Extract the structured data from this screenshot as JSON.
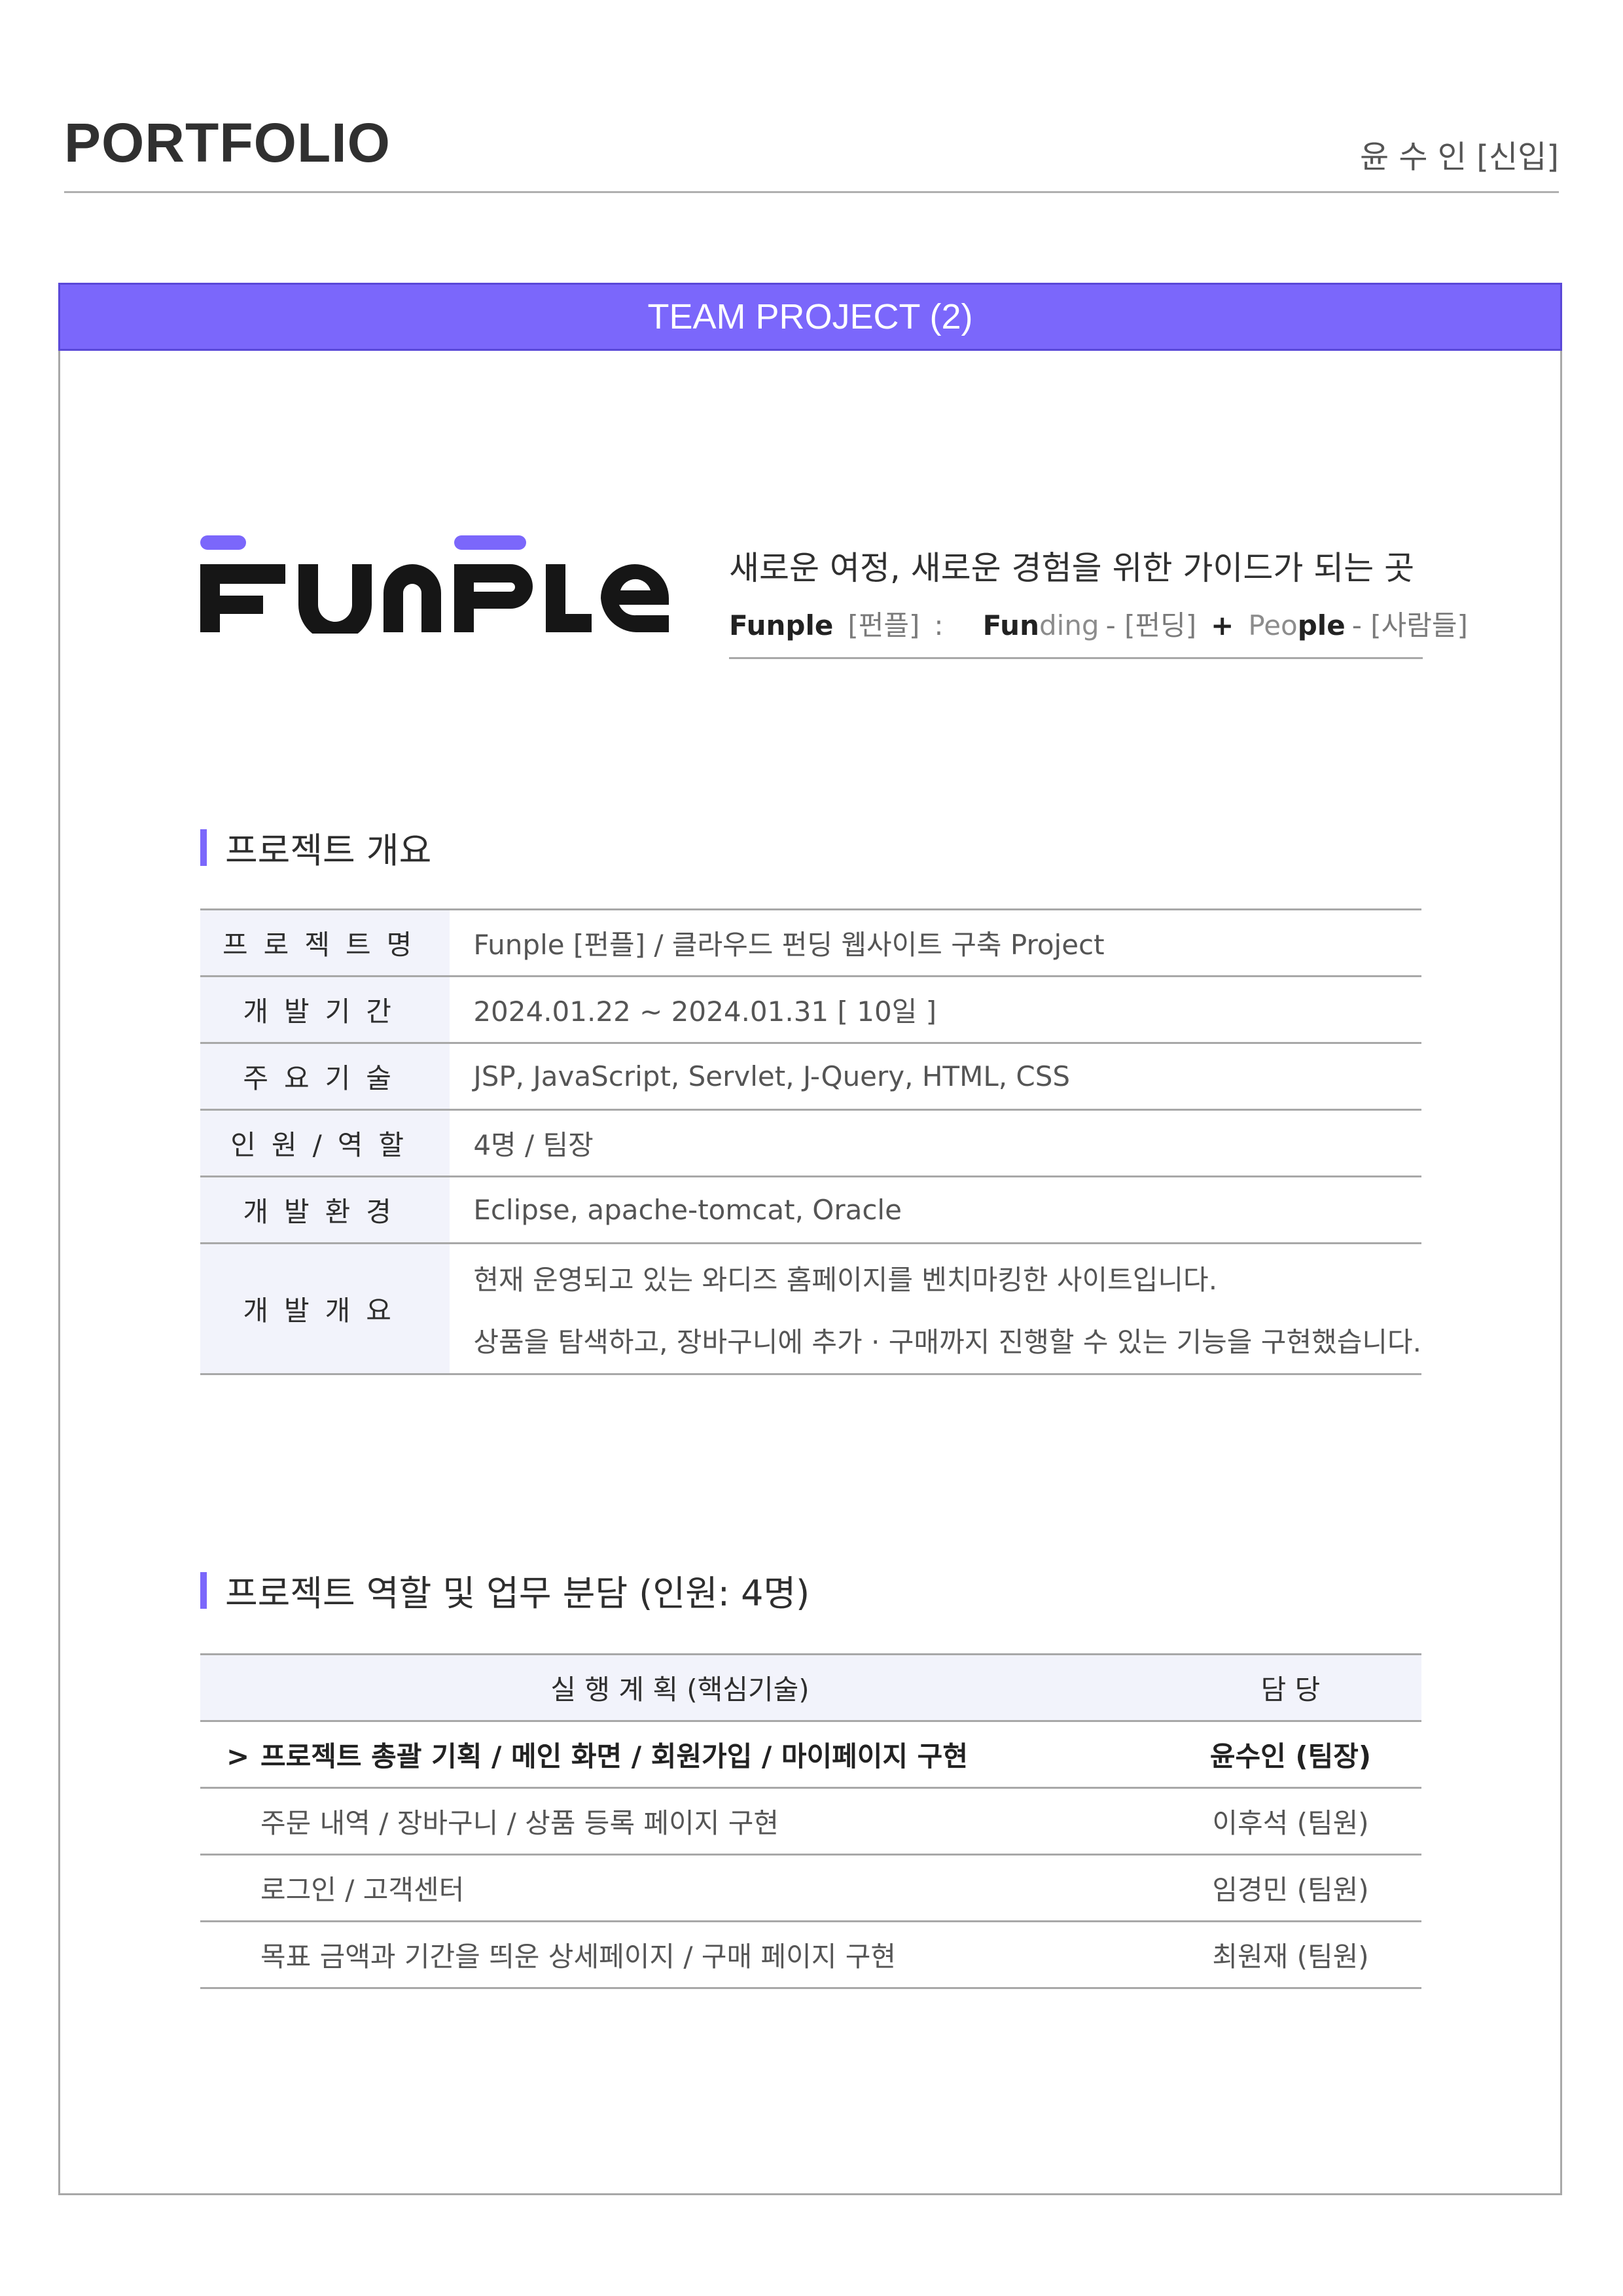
{
  "header": {
    "title": "PORTFOLIO",
    "author": "윤 수 인 [신입]"
  },
  "banner": {
    "label": "TEAM PROJECT (2)"
  },
  "logo": {
    "text": "FUNPLE",
    "accent_color": "#7b67fb"
  },
  "tagline": {
    "main": "새로운 여정, 새로운 경험을 위한 가이드가 되는 곳",
    "name": "Funple",
    "name_reading": "[펀플]",
    "colon": ":",
    "part1_bold": "Fun",
    "part1_grey": "ding",
    "part1_reading": "- [펀딩]",
    "plus": "+",
    "part2_grey": "Peo",
    "part2_bold": "ple",
    "part2_reading": "- [사람들]"
  },
  "overview": {
    "title": "프로젝트 개요",
    "rows": [
      {
        "label": "프로젝트명",
        "value": "Funple [펀플]   /   클라우드 펀딩 웹사이트 구축 Project"
      },
      {
        "label": "개발기간",
        "value": "2024.01.22 ~ 2024.01.31  [ 10일 ]"
      },
      {
        "label": "주요기술",
        "value": "JSP, JavaScript, Servlet, J-Query, HTML, CSS"
      },
      {
        "label": "인원/역할",
        "value": "4명 / 팀장"
      },
      {
        "label": "개발환경",
        "value": "Eclipse, apache-tomcat, Oracle"
      },
      {
        "label": "개발개요",
        "value": "현재 운영되고 있는 와디즈 홈페이지를 벤치마킹한 사이트입니다.",
        "value2": "상품을 탐색하고, 장바구니에 추가 · 구매까지 진행할 수 있는 기능을 구현했습니다."
      }
    ]
  },
  "roles": {
    "title": "프로젝트 역할 및 업무 분담 (인원: 4명)",
    "headers": [
      "실 행 계 획  (핵심기술)",
      "담  당"
    ],
    "rows": [
      {
        "marker": ">",
        "task": "프로젝트 총괄 기획 / 메인 화면 / 회원가입 /  마이페이지 구현",
        "owner": "윤수인 (팀장)"
      },
      {
        "task": "주문 내역 / 장바구니 / 상품 등록 페이지 구현",
        "owner": "이후석  (팀원)"
      },
      {
        "task": "로그인 / 고객센터",
        "owner": "임경민  (팀원)"
      },
      {
        "task": "목표 금액과 기간을 띄운 상세페이지 / 구매 페이지 구현",
        "owner": "최원재  (팀원)"
      }
    ]
  }
}
